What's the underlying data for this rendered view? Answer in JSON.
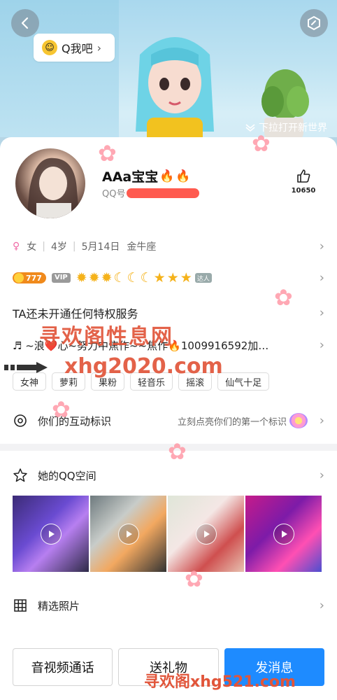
{
  "header": {
    "qme_label": "Q我吧",
    "pull_hint": "下拉打开新世界"
  },
  "profile": {
    "nickname": "AAa宝宝",
    "qq_prefix": "QQ号",
    "likes": "10650"
  },
  "info": {
    "gender": "女",
    "age": "4岁",
    "birthday": "5月14日",
    "zodiac": "金牛座"
  },
  "level": {
    "coin_value": "777",
    "vip_label": "VIP",
    "badge_label": "达人"
  },
  "privilege": "TA还未开通任何特权服务",
  "signature": "♬ ~浪❤️心~努力中焦作~~焦作🔥1009916592加…",
  "tags": [
    "女神",
    "萝莉",
    "果粉",
    "轻音乐",
    "摇滚",
    "仙气十足"
  ],
  "interact": {
    "label": "你们的互动标识",
    "hint": "立刻点亮你们的第一个标识"
  },
  "zone": {
    "label": "她的QQ空间"
  },
  "photos_row": {
    "label": "精选照片"
  },
  "actions": {
    "call": "音视频通话",
    "gift": "送礼物",
    "message": "发消息"
  },
  "watermarks": {
    "line1": "寻欢阁性息网",
    "line2": "xhg2020.com",
    "line3": "寻欢阁xhg521.com"
  },
  "colors": {
    "primary": "#1e8bff",
    "watermark": "#e1553a",
    "gender": "#f06aa6"
  }
}
